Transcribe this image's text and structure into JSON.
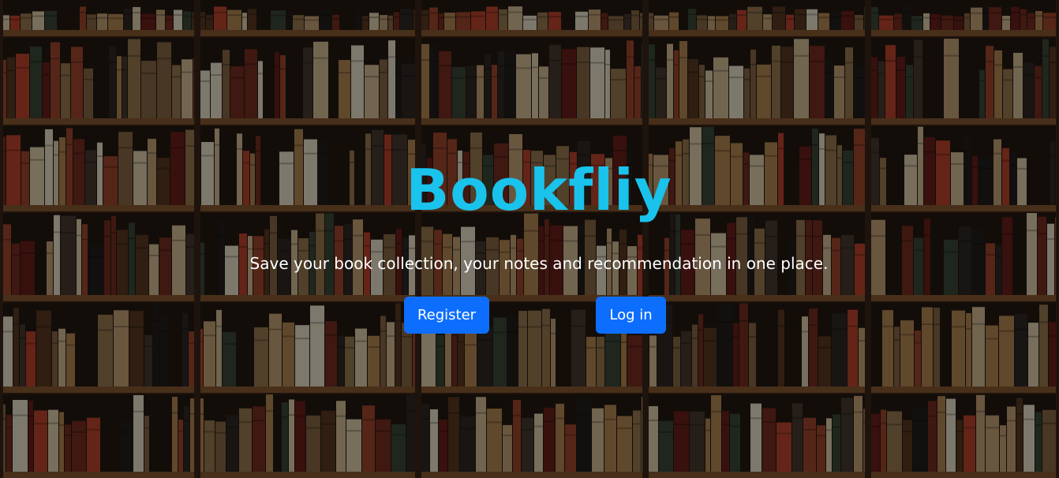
{
  "hero": {
    "brand": "Bookfliy",
    "tagline": "Save your book collection, your notes and recommendation in one place.",
    "register_label": "Register",
    "login_label": "Log in"
  },
  "colors": {
    "brand": "#19c3ec",
    "button": "#0d6efd",
    "button_text": "#ffffff",
    "tagline": "#ffffff"
  }
}
